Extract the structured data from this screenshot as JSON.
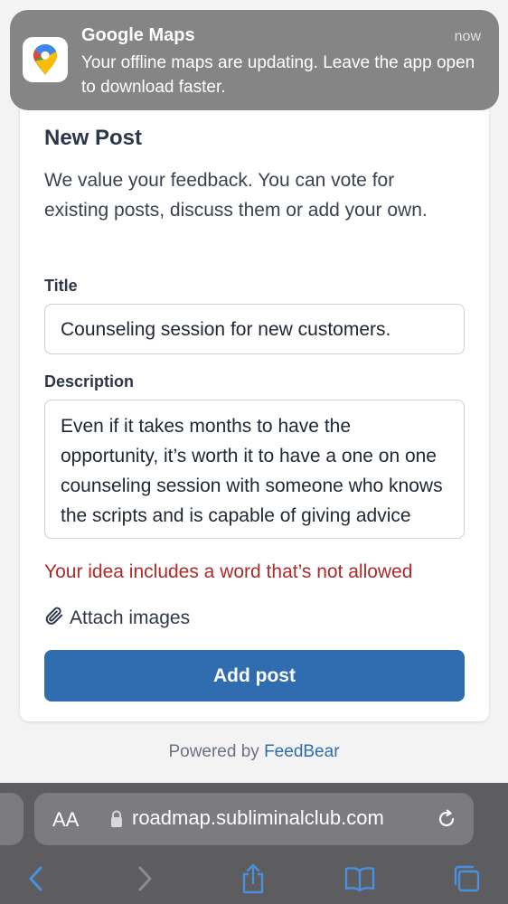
{
  "notification": {
    "app": "Google Maps",
    "time": "now",
    "message": "Your offline maps are updating. Leave the app open to download faster.",
    "icon": "google-maps-pin-icon"
  },
  "form": {
    "heading": "New Post",
    "intro": "We value your feedback. You can vote for existing posts, discuss them or add your own.",
    "title_label": "Title",
    "title_value": "Counseling session for new customers.",
    "description_label": "Description",
    "description_value": "Even if it takes months to have the opportunity, it’s worth it to have a one on one counseling session with someone who knows the scripts and is capable of giving advice",
    "error": "Your idea includes a word that’s not allowed",
    "attach_label": "Attach images",
    "submit_label": "Add post"
  },
  "footer": {
    "powered_prefix": "Powered by",
    "powered_brand": "FeedBear"
  },
  "browser": {
    "text_size_label": "AA",
    "url": "roadmap.subliminalclub.com"
  },
  "colors": {
    "accent": "#2f6cb0",
    "error": "#b02a2a",
    "toolbar_icon": "#4a8fe0"
  }
}
